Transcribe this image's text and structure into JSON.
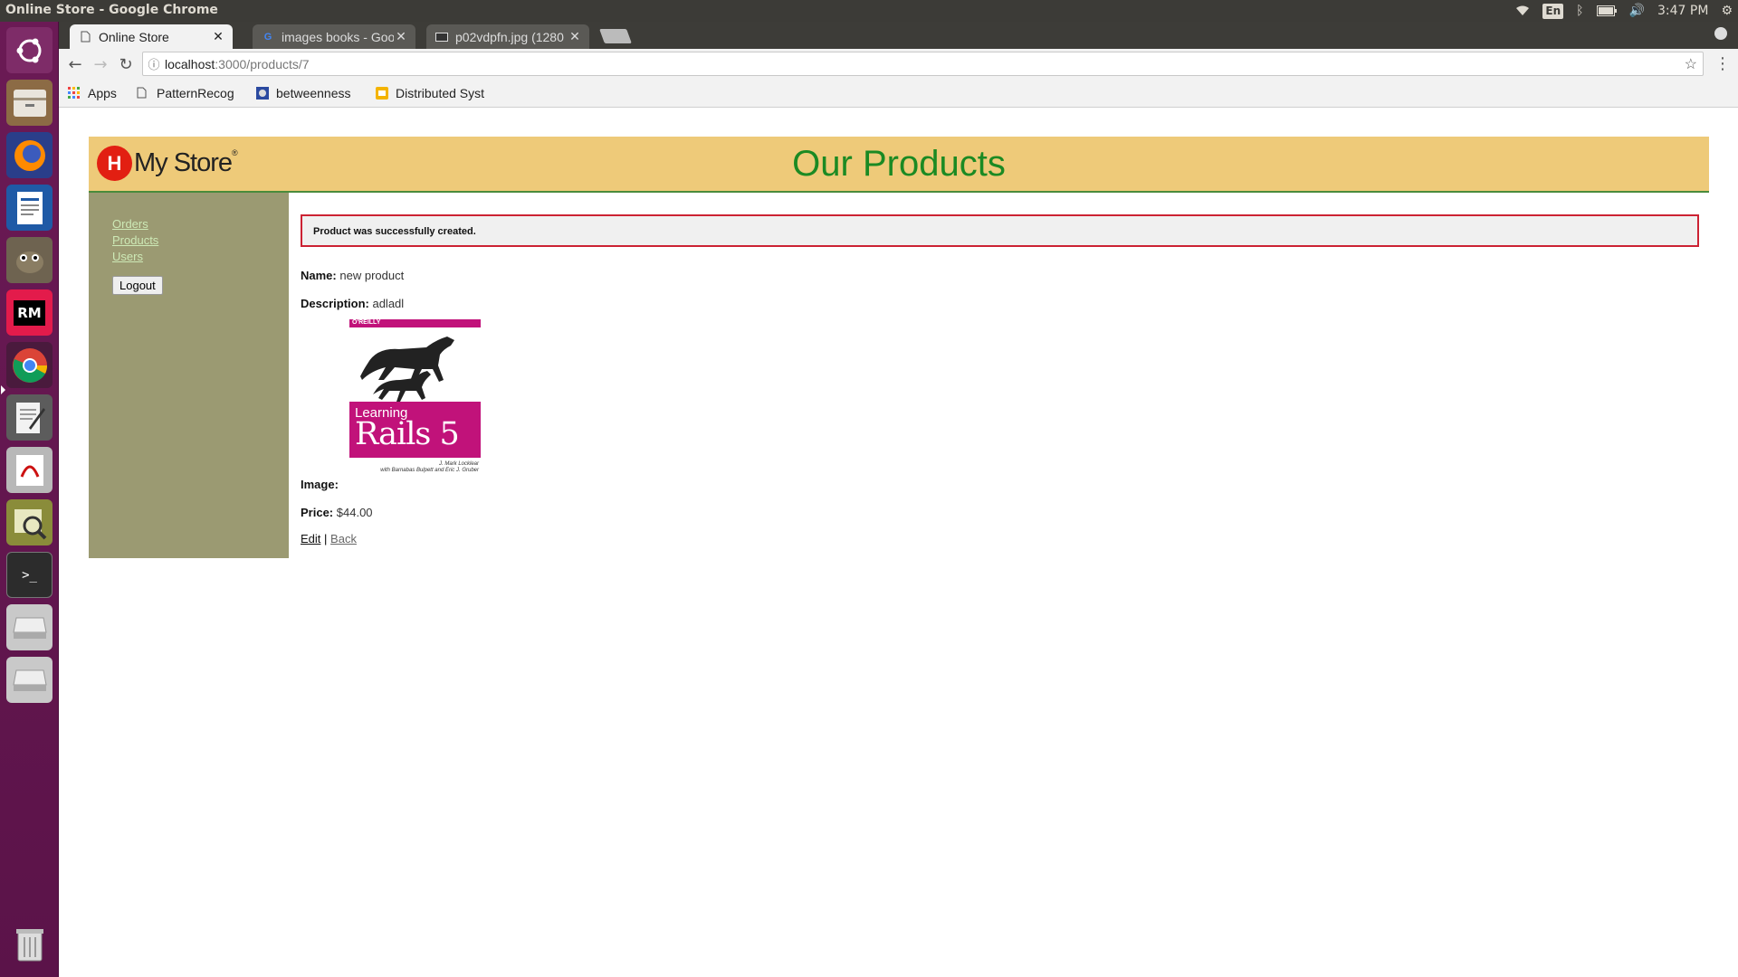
{
  "os": {
    "window_title": "Online Store - Google Chrome",
    "lang": "En",
    "clock": "3:47 PM"
  },
  "launcher": {
    "items": [
      "ubuntu-dash-icon",
      "file-manager-icon",
      "firefox-icon",
      "writer-icon",
      "gimp-icon",
      "rubymine-icon",
      "chrome-icon",
      "text-editor-icon",
      "document-viewer-icon",
      "image-viewer-icon",
      "terminal-icon",
      "drive-icon",
      "drive-icon",
      "trash-icon"
    ]
  },
  "browser": {
    "tabs": [
      {
        "title": "Online Store",
        "active": true
      },
      {
        "title": "images books - Goo",
        "active": false
      },
      {
        "title": "p02vdpfn.jpg (1280",
        "active": false
      }
    ],
    "url_host": "localhost",
    "url_path": ":3000/products/7",
    "bookmarks": [
      "Apps",
      "PatternRecog",
      "betweenness",
      "Distributed Syst"
    ]
  },
  "page": {
    "logo_text": "My Store",
    "logo_mark": "H",
    "heading": "Our Products",
    "nav": [
      "Orders",
      "Products",
      "Users"
    ],
    "logout": "Logout",
    "notice": "Product was successfully created.",
    "name_label": "Name:",
    "name_value": "new product",
    "description_label": "Description:",
    "description_value": "adladl",
    "image_label": "Image:",
    "price_label": "Price:",
    "price_value": "$44.00",
    "edit_link": "Edit",
    "separator": "|",
    "back_link": "Back",
    "book": {
      "publisher": "O'REILLY",
      "learning": "Learning",
      "title": "Rails 5",
      "author": "J. Mark Locklear",
      "coauthors": "with Barnabas Bulpett and Eric J. Gruber"
    }
  },
  "colors": {
    "header_bg": "#eeca79",
    "heading_green": "#1b8a23",
    "sidebar_bg": "#9b9a72",
    "notice_border": "#cc2233"
  }
}
